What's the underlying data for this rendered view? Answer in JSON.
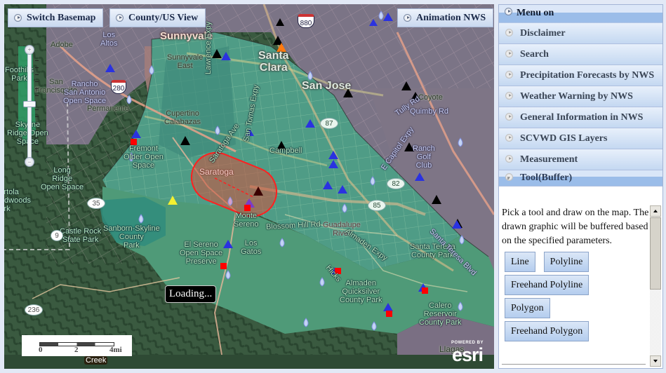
{
  "map": {
    "buttons": {
      "switch_basemap": "Switch Basemap",
      "county_view": "County/US View",
      "animation": "Animation NWS"
    },
    "loading_text": "Loading...",
    "scalebar": {
      "labels": [
        "0",
        "2",
        "4mi"
      ]
    },
    "attribution": {
      "powered_by": "POWERED BY",
      "logo": "esri"
    },
    "labels": {
      "sunnyvale": "Sunnyvale",
      "sunnyvale_east": "Sunnyvale\nEast",
      "santa_clara": "Santa\nClara",
      "san_jose": "San Jose",
      "los_altos": "Los\nAltos",
      "adobe": "Adobe",
      "foothills_park": "Foothills\nPark",
      "san_francisquito": "San\nFrancisquito",
      "rancho_san_antonio": "Rancho\nSan Antonio\nOpen Space",
      "permanente": "Permanente",
      "cupertino": "Cupertino\nCalabazas",
      "lawrence_expy": "Lawrence Expy",
      "san_tomas_expy": "San Tomas Expy",
      "skyline_ridge": "Skyline\nRidge Open\nSpace",
      "fremont_older": "Fremont\nOlder Open\nSpace",
      "campbell": "Campbell",
      "saratoga": "Saratoga",
      "saratoga_ave": "Saratoga Ave",
      "long_ridge": "Long\nRidge\nOpen Space",
      "portola": "Portola\nRedwoods\nPark",
      "castle_rock": "Castle Rock\nState Park",
      "sanborn": "Sanborn-Skyline\nCounty\nPark",
      "monte_sereno": "Monte\nSereno",
      "los_gatos": "Los\nGatos",
      "el_sereno": "El Sereno\nOpen Space\nPreserve",
      "blossom_hill": "Blossom Hill Rd",
      "guadalupe": "Guadalupe\nRiver",
      "almaden_expy": "Almaden Expy",
      "almaden_park": "Almaden\nQuicksilver\nCounty Park",
      "santa_teresa_park": "Santa Teresa\nCounty Park",
      "santa_teresa_blvd": "Santa Teresa Blvd",
      "calero": "Calero\nReservoir\nCounty Park",
      "hicks": "Hicks",
      "coyote": "Coyote",
      "tully": "Tully Rd",
      "quimby": "Quimby Rd",
      "capitol": "E Capitol Expy",
      "ranch_golf": "Ranch\nGolf\nClub",
      "creek": "Creek",
      "llagas": "Llagas"
    },
    "shields": {
      "i880": "880",
      "i280": "280",
      "sr87": "87",
      "sr82": "82",
      "sr85": "85",
      "sr35": "35",
      "sr9": "9",
      "sr236": "236"
    },
    "colors": {
      "black_triangle": "#000000",
      "blue_triangle": "#2a32e0",
      "orange_triangle": "#ff7a10",
      "yellow_triangle": "#f4f030",
      "red_square": "#ff0000",
      "buffer_fill": "#d4503c",
      "buffer_stroke": "#ff2020"
    }
  },
  "sidebar": {
    "header": "Menu on",
    "items": [
      {
        "label": "Disclaimer"
      },
      {
        "label": "Search"
      },
      {
        "label": "Precipitation Forecasts by NWS"
      },
      {
        "label": "Weather Warning by NWS"
      },
      {
        "label": "General Information in NWS"
      },
      {
        "label": "SCVWD GIS Layers"
      },
      {
        "label": "Measurement"
      },
      {
        "label": "Tool(Buffer)"
      }
    ],
    "tool_panel": {
      "description": "Pick a tool and draw on the map. The drawn graphic will be buffered based on the specified parameters.",
      "buttons": [
        "Line",
        "Polyline",
        "Freehand Polyline",
        "Polygon",
        "Freehand Polygon"
      ]
    }
  }
}
